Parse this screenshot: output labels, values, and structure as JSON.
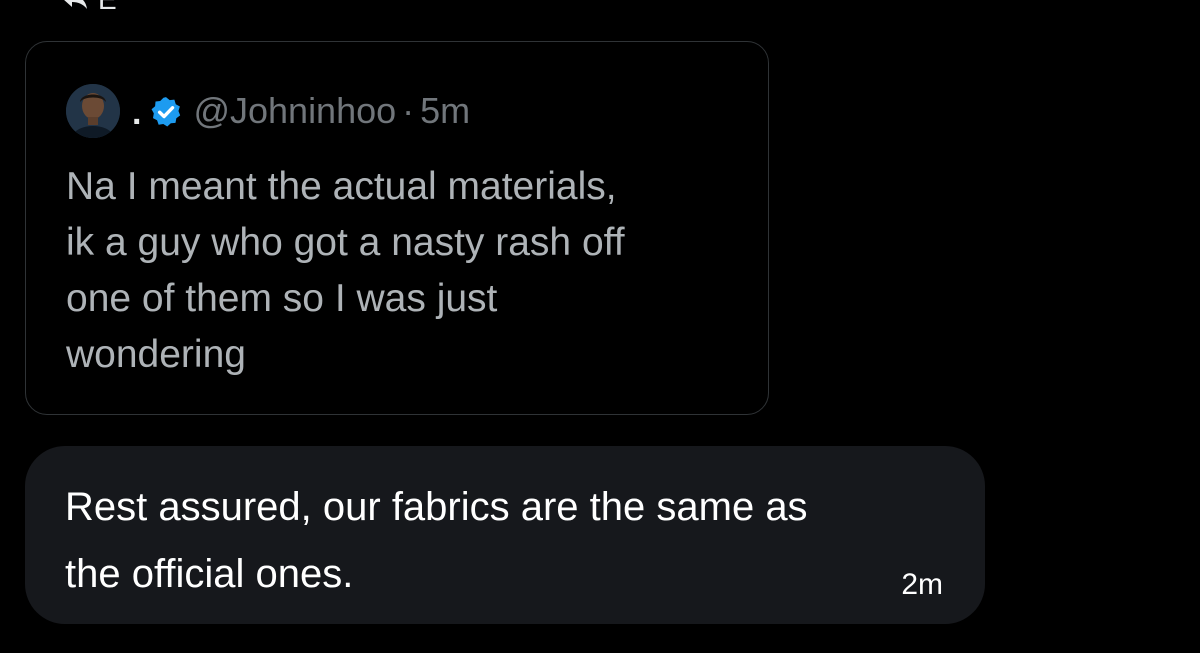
{
  "reply_indicator": {
    "icon": "reply-arrow-icon",
    "label": "E"
  },
  "quoted_tweet": {
    "avatar_icon": "profile-avatar",
    "display_name": ".",
    "verified_icon": "verified-badge-icon",
    "verified_color": "#1d9bf0",
    "handle": "@Johninhoo",
    "separator": "·",
    "time": "5m",
    "text_lines": [
      "Na I meant the actual materials,",
      "ik a guy who got a nasty rash off",
      "one of them so I was just",
      "wondering"
    ]
  },
  "message": {
    "text_lines": [
      "Rest assured, our fabrics are the same as",
      "the official ones."
    ],
    "time": "2m",
    "bubble_color": "#16181c"
  }
}
